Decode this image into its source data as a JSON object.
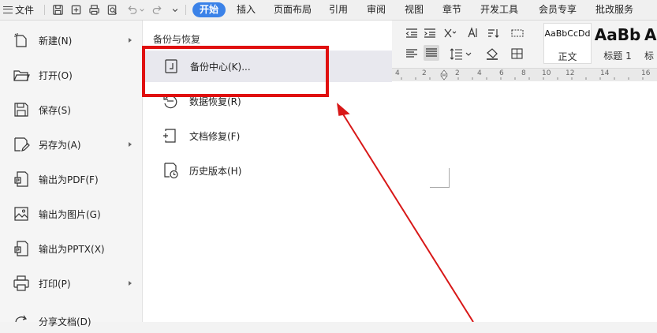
{
  "menubar": {
    "file_label": "文件",
    "tabs": [
      "开始",
      "插入",
      "页面布局",
      "引用",
      "审阅",
      "视图",
      "章节",
      "开发工具",
      "会员专享",
      "批改服务"
    ],
    "active_tab": "开始"
  },
  "file_menu": {
    "items": [
      {
        "label": "新建(N)",
        "icon": "new-file-icon",
        "has_submenu": true
      },
      {
        "label": "打开(O)",
        "icon": "folder-open-icon",
        "has_submenu": false
      },
      {
        "label": "保存(S)",
        "icon": "save-icon",
        "has_submenu": false
      },
      {
        "label": "另存为(A)",
        "icon": "save-as-icon",
        "has_submenu": true
      },
      {
        "label": "输出为PDF(F)",
        "icon": "export-pdf-icon",
        "has_submenu": false
      },
      {
        "label": "输出为图片(G)",
        "icon": "export-image-icon",
        "has_submenu": false
      },
      {
        "label": "输出为PPTX(X)",
        "icon": "export-pptx-icon",
        "has_submenu": false
      },
      {
        "label": "打印(P)",
        "icon": "print-icon",
        "has_submenu": true
      },
      {
        "label": "分享文档(D)",
        "icon": "share-icon",
        "has_submenu": false
      }
    ]
  },
  "submenu": {
    "title": "备份与恢复",
    "items": [
      {
        "label": "备份中心(K)...",
        "icon": "backup-center-icon"
      },
      {
        "label": "数据恢复(R)",
        "icon": "data-recovery-icon"
      },
      {
        "label": "文档修复(F)",
        "icon": "document-repair-icon"
      },
      {
        "label": "历史版本(H)",
        "icon": "history-version-icon"
      }
    ]
  },
  "styles": {
    "tiles": [
      {
        "sample": "AaBbCcDd",
        "name": "正文"
      },
      {
        "sample": "AaBb",
        "name": "标题 1"
      },
      {
        "sample": "A",
        "name": "标"
      }
    ]
  },
  "ruler": {
    "numbers": [
      "4",
      "2",
      "2",
      "4",
      "6",
      "8",
      "10",
      "12",
      "14",
      "16"
    ]
  },
  "colors": {
    "accent": "#3b82e8",
    "highlight_box": "#e01010",
    "arrow": "#d81818"
  }
}
